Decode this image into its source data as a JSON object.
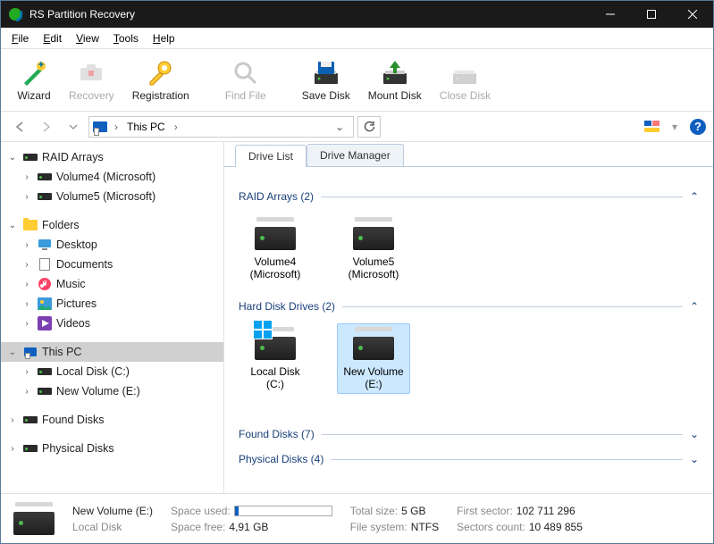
{
  "window": {
    "title": "RS Partition Recovery"
  },
  "menu": {
    "file": "File",
    "edit": "Edit",
    "view": "View",
    "tools": "Tools",
    "help": "Help"
  },
  "toolbar": {
    "wizard": "Wizard",
    "recovery": "Recovery",
    "registration": "Registration",
    "findfile": "Find File",
    "savedisk": "Save Disk",
    "mountdisk": "Mount Disk",
    "closedisk": "Close Disk"
  },
  "nav": {
    "location": "This PC",
    "sep": "›"
  },
  "tree": {
    "raid": {
      "label": "RAID Arrays",
      "v4": "Volume4 (Microsoft)",
      "v5": "Volume5 (Microsoft)"
    },
    "folders": {
      "label": "Folders",
      "desktop": "Desktop",
      "documents": "Documents",
      "music": "Music",
      "pictures": "Pictures",
      "videos": "Videos"
    },
    "thispc": {
      "label": "This PC",
      "local": "Local Disk (C:)",
      "newvol": "New Volume (E:)"
    },
    "found": "Found Disks",
    "physical": "Physical Disks"
  },
  "tabs": {
    "drivelist": "Drive List",
    "drivemgr": "Drive Manager"
  },
  "sections": {
    "raid": "RAID Arrays (2)",
    "hdd": "Hard Disk Drives (2)",
    "found": "Found Disks (7)",
    "physical": "Physical Disks (4)"
  },
  "drives": {
    "v4": "Volume4 (Microsoft)",
    "v5": "Volume5 (Microsoft)",
    "local": "Local Disk (C:)",
    "newvol": "New Volume (E:)"
  },
  "status": {
    "name": "New Volume (E:)",
    "type": "Local Disk",
    "used_lbl": "Space used:",
    "free_lbl": "Space free:",
    "free_val": "4,91 GB",
    "total_lbl": "Total size:",
    "total_val": "5 GB",
    "fs_lbl": "File system:",
    "fs_val": "NTFS",
    "first_lbl": "First sector:",
    "first_val": "102 711 296",
    "sec_lbl": "Sectors count:",
    "sec_val": "10 489 855"
  }
}
